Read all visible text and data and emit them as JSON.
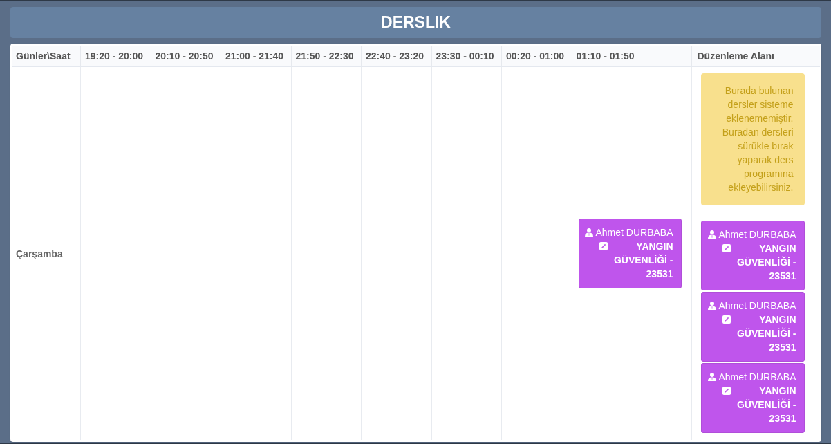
{
  "title": "DERSLIK",
  "table": {
    "columns": [
      "Günler\\Saat",
      "19:20 - 20:00",
      "20:10 - 20:50",
      "21:00 - 21:40",
      "21:50 - 22:30",
      "22:40 - 23:20",
      "23:30 - 00:10",
      "00:20 - 01:00",
      "01:10 - 01:50",
      "Düzenleme Alanı"
    ],
    "rows": [
      {
        "cells": [
          "Çarşamba",
          "",
          "",
          "",
          "",
          "",
          "",
          "",
          {
            "kind": "slot",
            "lessons": [
              {
                "teacher": "Ahmet DURBABA",
                "course": "YANGIN GÜVENLİĞİ - 23531"
              }
            ]
          },
          {
            "kind": "holding_area",
            "note": "Burada bulunan dersler sisteme eklenememiştir. Buradan dersleri sürükle bırak yaparak ders programına ekleyebilirsiniz.",
            "lessons": [
              {
                "teacher": "Ahmet DURBABA",
                "course": "YANGIN GÜVENLİĞİ - 23531"
              },
              {
                "teacher": "Ahmet DURBABA",
                "course": "YANGIN GÜVENLİĞİ - 23531"
              },
              {
                "teacher": "Ahmet DURBABA",
                "course": "YANGIN GÜVENLİĞİ - 23531"
              }
            ]
          }
        ]
      }
    ]
  }
}
